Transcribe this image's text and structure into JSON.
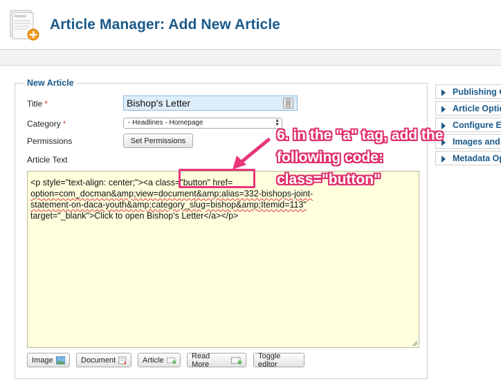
{
  "header": {
    "title": "Article Manager: Add New Article",
    "icon_caption": "Articles"
  },
  "fieldset": {
    "legend": "New Article"
  },
  "form": {
    "title_label": "Title",
    "title_value": "Bishop's Letter",
    "category_label": "Category",
    "category_value": "- Headlines - Homepage",
    "permissions_label": "Permissions",
    "set_permissions_label": "Set Permissions",
    "article_text_label": "Article Text",
    "required_marker": "*"
  },
  "editor": {
    "line1_a": "<p style=\"text-align: center;\"><a ",
    "line1_b": "class=\"button\"",
    "line1_c": " href=",
    "line2": "option=com_docman&amp;view=document&amp;alias=332-bishops-joint-",
    "line3": "statement-on-daca-youth&amp;category_slug=bishop&amp;Itemid=113\"",
    "line4": "target=\"_blank\">Click to open Bishop's Letter</a></p>"
  },
  "editor_buttons": {
    "image": "Image",
    "document": "Document",
    "article": "Article",
    "read_more": "Read More",
    "toggle_editor": "Toggle editor"
  },
  "sliders": [
    {
      "label": "Publishing Options"
    },
    {
      "label": "Article Options"
    },
    {
      "label": "Configure Edit Screen"
    },
    {
      "label": "Images and Links"
    },
    {
      "label": "Metadata Options"
    }
  ],
  "annotation": {
    "line1": "6. in the \"a\" tag, add the",
    "line2": "following code:",
    "line3": "class=\"button\""
  },
  "colors": {
    "accent": "#1b5a8a",
    "annotation": "#e8357a",
    "editor_bg": "#ffffdd",
    "title_bg": "#ddeefa"
  }
}
